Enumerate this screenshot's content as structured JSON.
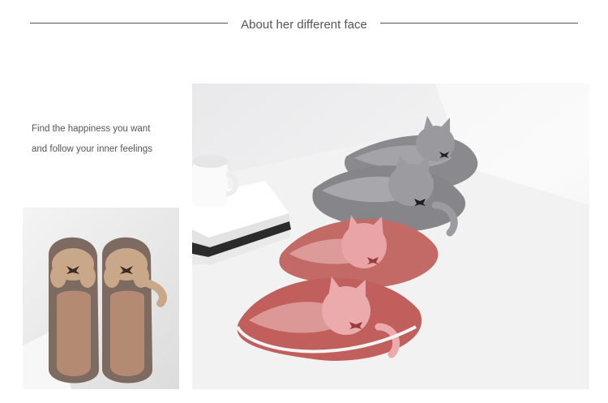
{
  "header": {
    "title": "About her different face"
  },
  "intro": {
    "line1": "Find the happiness you want",
    "line2": "and follow your inner feelings"
  },
  "colors": {
    "text": "#555555",
    "divider": "#555555",
    "slipper_brown": "#7d6a60",
    "slipper_gray": "#8a8a8e",
    "slipper_pink": "#c46a66"
  }
}
